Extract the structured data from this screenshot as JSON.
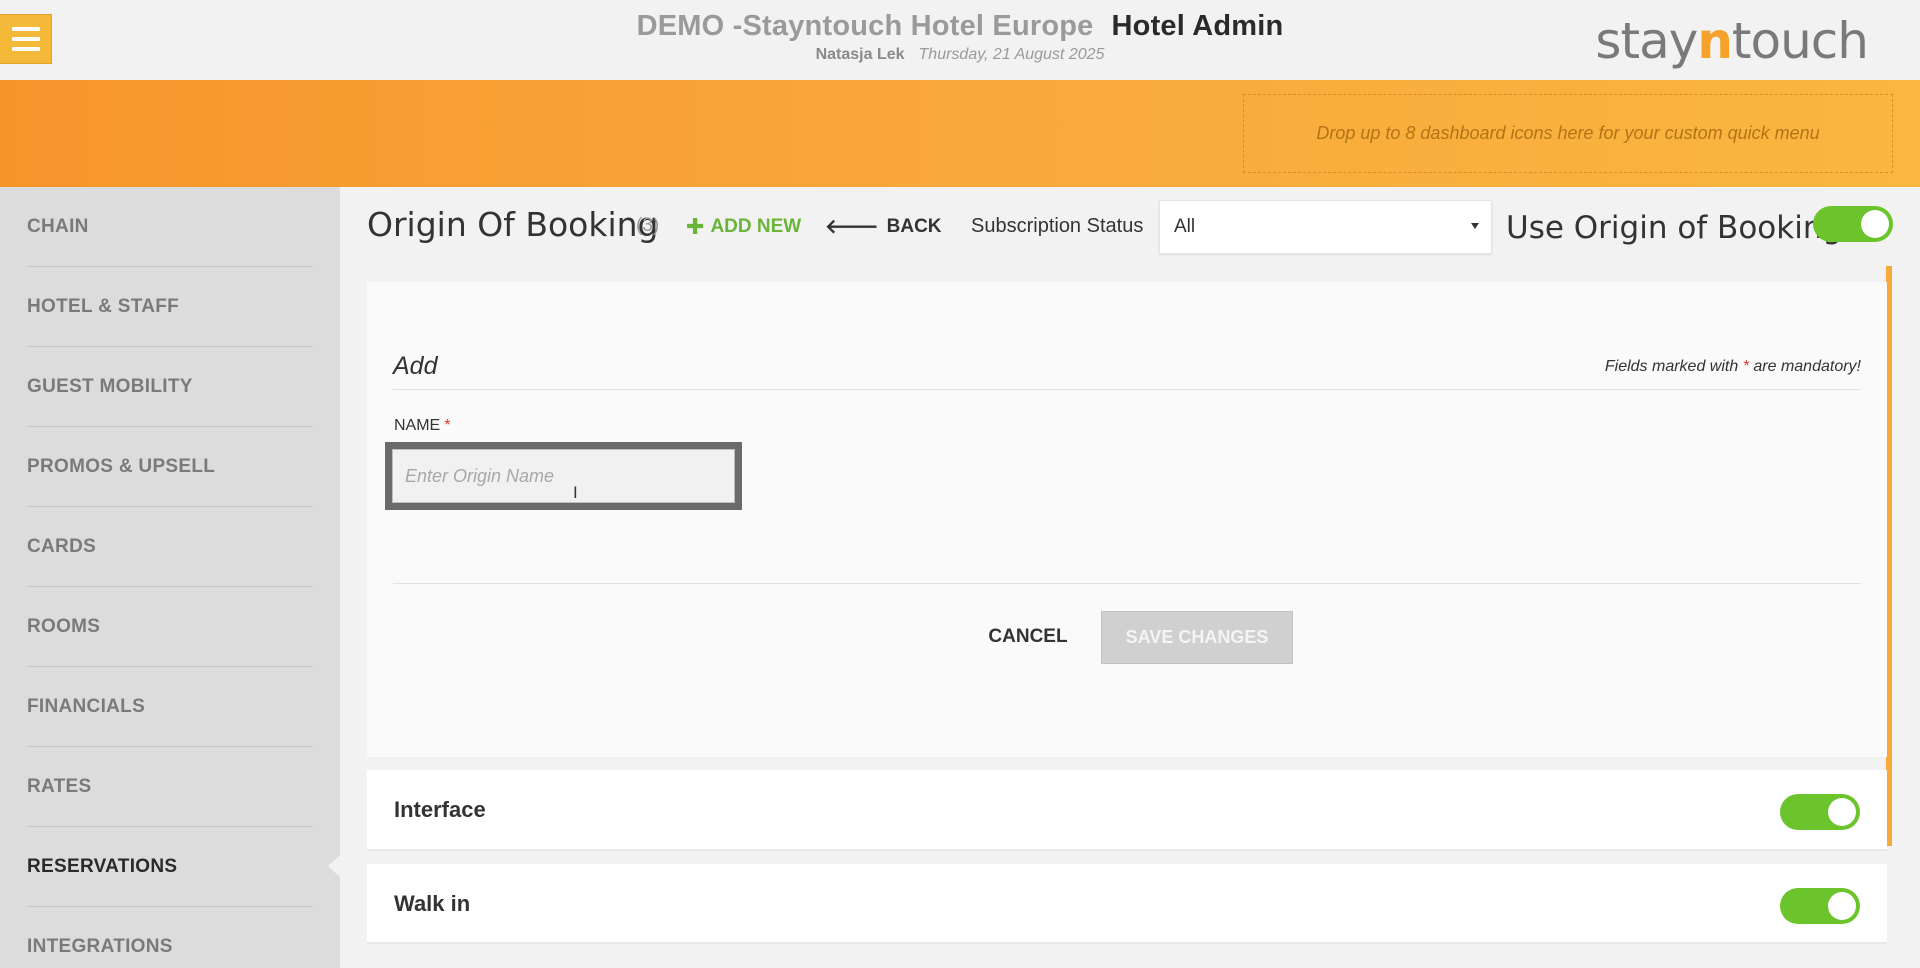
{
  "header": {
    "hotel_name": "DEMO -Stayntouch Hotel Europe",
    "app_name": "Hotel Admin",
    "user_name": "Natasja Lek",
    "date": "Thursday, 21 August 2025",
    "logo_prefix": "stay",
    "logo_n": "n",
    "logo_suffix": "touch",
    "menu_icon": "hamburger-icon"
  },
  "quick_menu": {
    "placeholder": "Drop up to 8 dashboard icons here for your custom quick menu"
  },
  "sidebar": {
    "items": [
      {
        "label": "CHAIN"
      },
      {
        "label": "HOTEL & STAFF"
      },
      {
        "label": "GUEST MOBILITY"
      },
      {
        "label": "PROMOS & UPSELL"
      },
      {
        "label": "CARDS"
      },
      {
        "label": "ROOMS"
      },
      {
        "label": "FINANCIALS"
      },
      {
        "label": "RATES"
      },
      {
        "label": "RESERVATIONS"
      },
      {
        "label": "INTEGRATIONS"
      }
    ],
    "active": "RESERVATIONS"
  },
  "page": {
    "title": "Origin Of Booking",
    "count": "(3)",
    "add_new_label": "ADD NEW",
    "add_new_icon": "✚",
    "back_label": "BACK",
    "back_icon": "🡐",
    "subscription_status_label": "Subscription Status",
    "subscription_status_value": "All",
    "use_origin_label": "Use Origin of Booking",
    "use_origin_enabled": true
  },
  "form": {
    "heading": "Add",
    "mandatory_prefix": "Fields marked with ",
    "mandatory_star": "*",
    "mandatory_suffix": " are mandatory!",
    "name_label": "NAME",
    "name_required": "*",
    "name_placeholder": "Enter Origin Name",
    "name_value": "",
    "cancel_label": "CANCEL",
    "save_label": "SAVE CHANGES"
  },
  "origins": [
    {
      "name": "Interface",
      "enabled": true
    },
    {
      "name": "Walk in",
      "enabled": true
    }
  ],
  "colors": {
    "accent_orange": "#f9a83a",
    "toggle_on": "#6cc42c",
    "add_new_green": "#6ab43a",
    "required_red": "#e03a3a"
  }
}
